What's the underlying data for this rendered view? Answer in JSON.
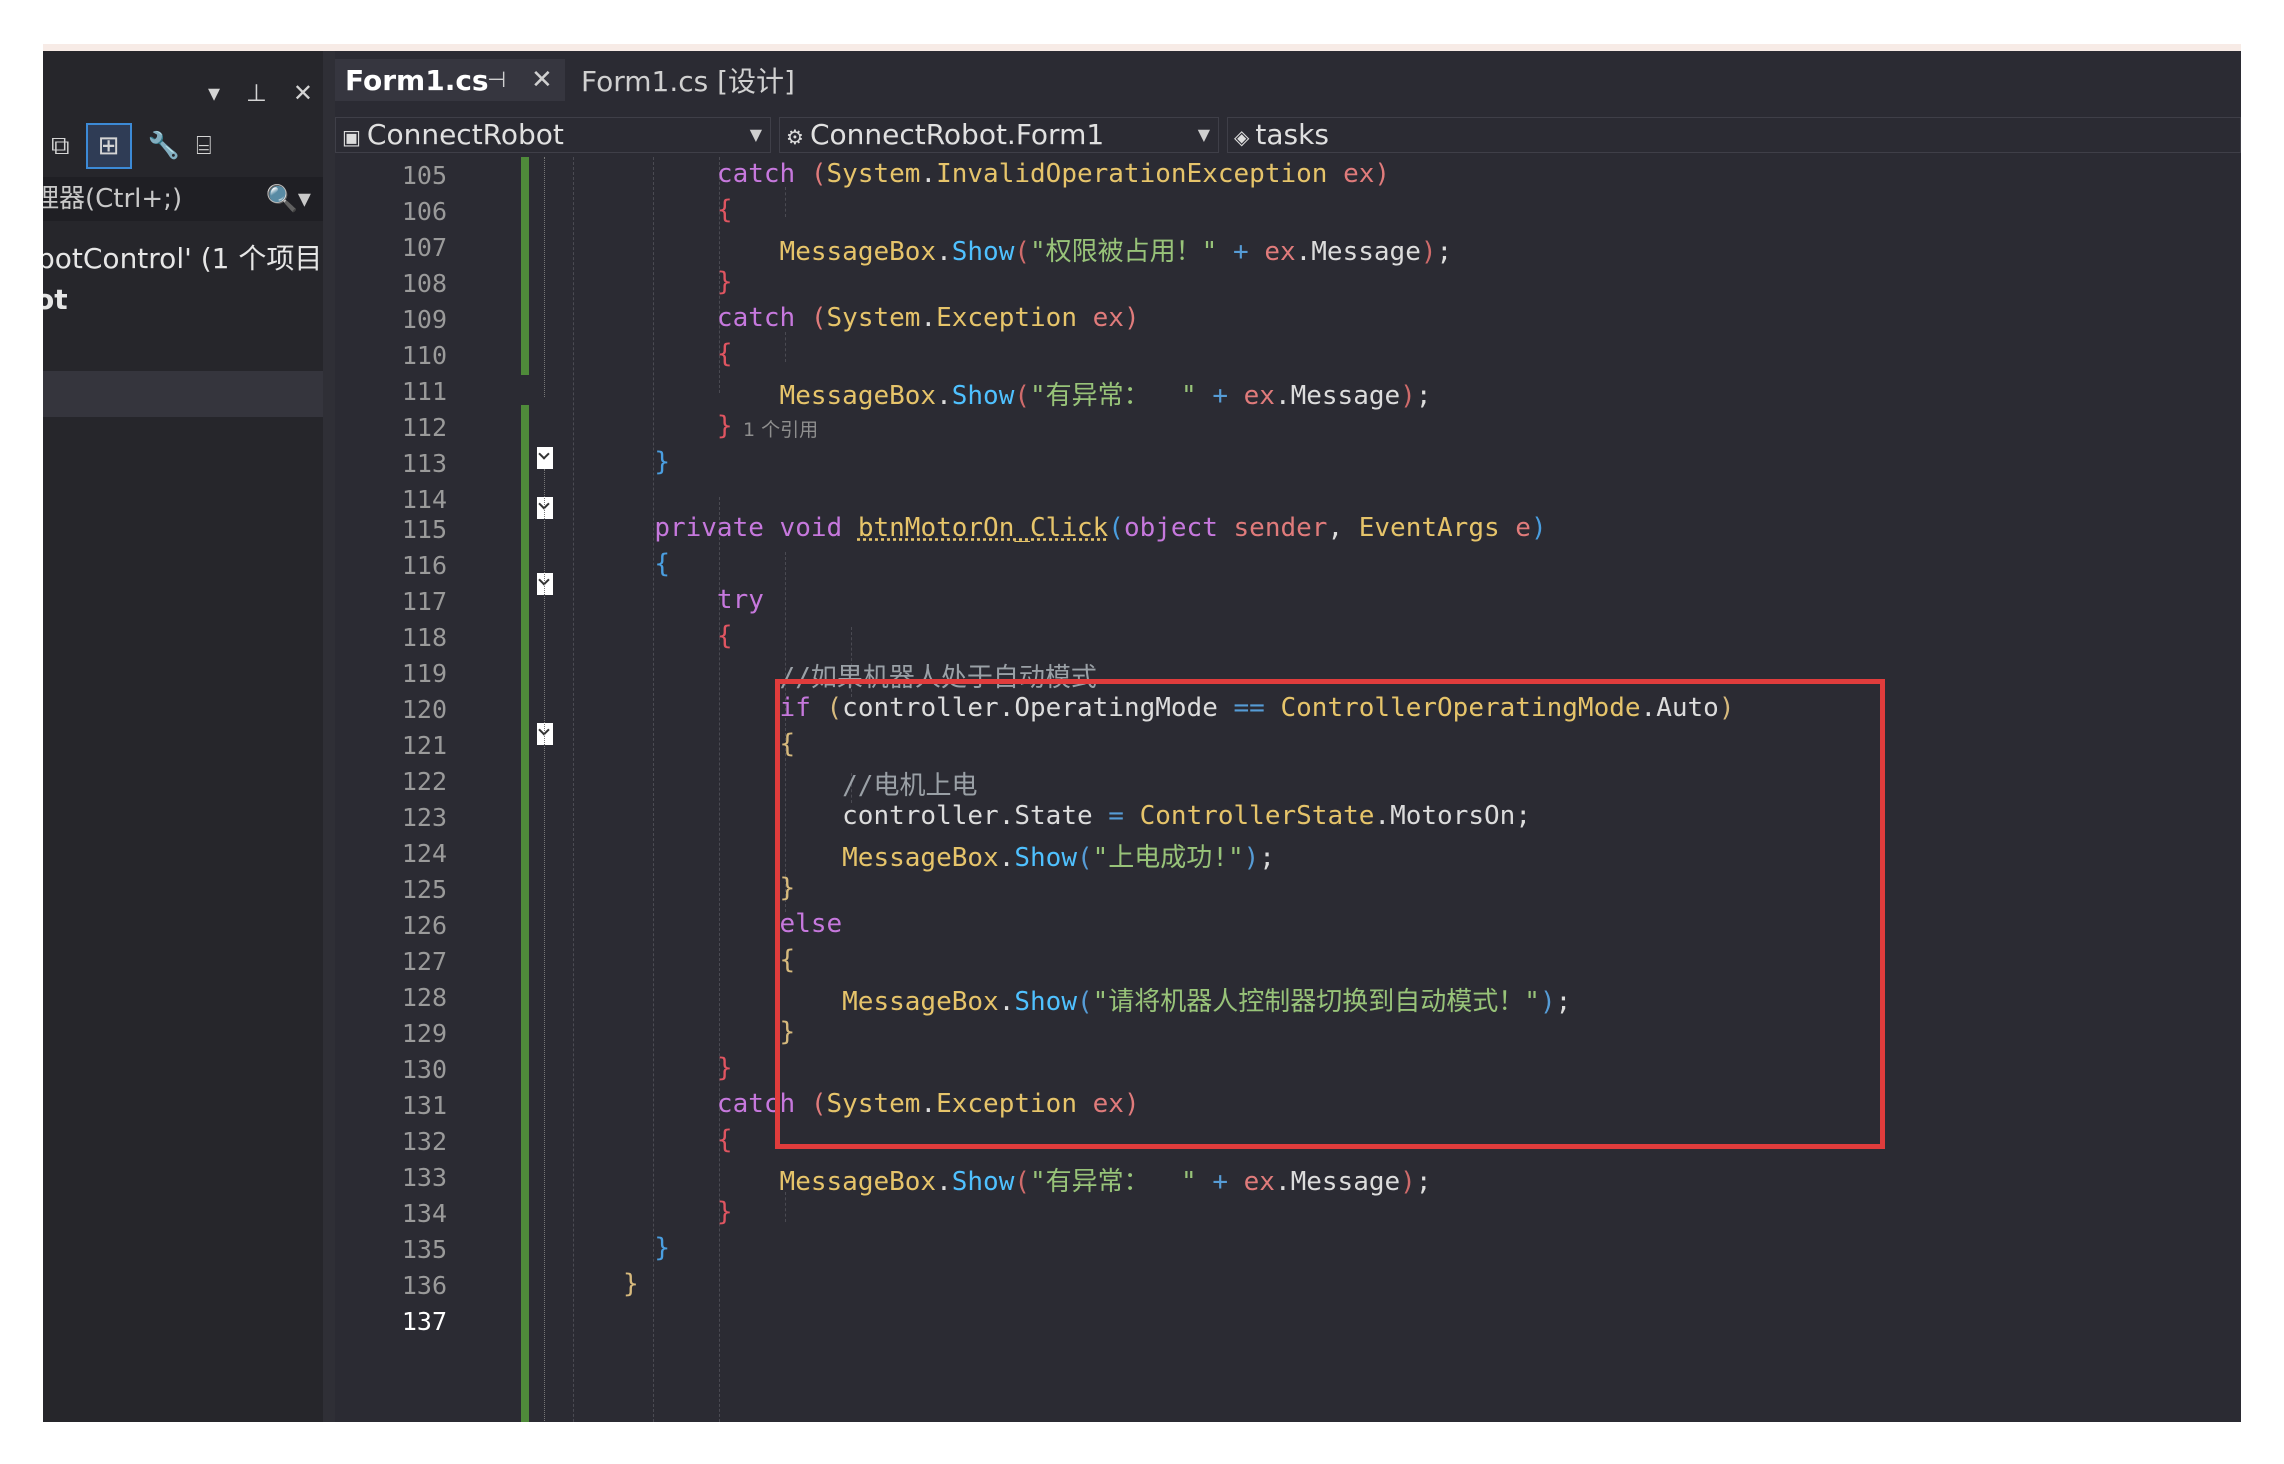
{
  "left_panel": {
    "search_placeholder": "理器(Ctrl+;)",
    "solution_line": "botControl' (1 个项目",
    "project_line": "ot"
  },
  "tabs": [
    {
      "label": "Form1.cs",
      "active": true
    },
    {
      "label": "Form1.cs [设计]",
      "active": false
    }
  ],
  "nav": {
    "project": "ConnectRobot",
    "class": "ConnectRobot.Form1",
    "member": "tasks"
  },
  "editor": {
    "reference_hint": "1 个引用",
    "current_line": "137",
    "line_numbers": [
      "105",
      "106",
      "107",
      "108",
      "109",
      "110",
      "111",
      "112",
      "113",
      "114",
      "115",
      "116",
      "117",
      "118",
      "119",
      "120",
      "121",
      "122",
      "123",
      "124",
      "125",
      "126",
      "127",
      "128",
      "129",
      "130",
      "131",
      "132",
      "133",
      "134",
      "135",
      "136",
      "137"
    ]
  },
  "colors": {
    "background": "#2b2b33",
    "highlight_box": "#e03c3c",
    "change_bar": "#4f8a3a"
  }
}
